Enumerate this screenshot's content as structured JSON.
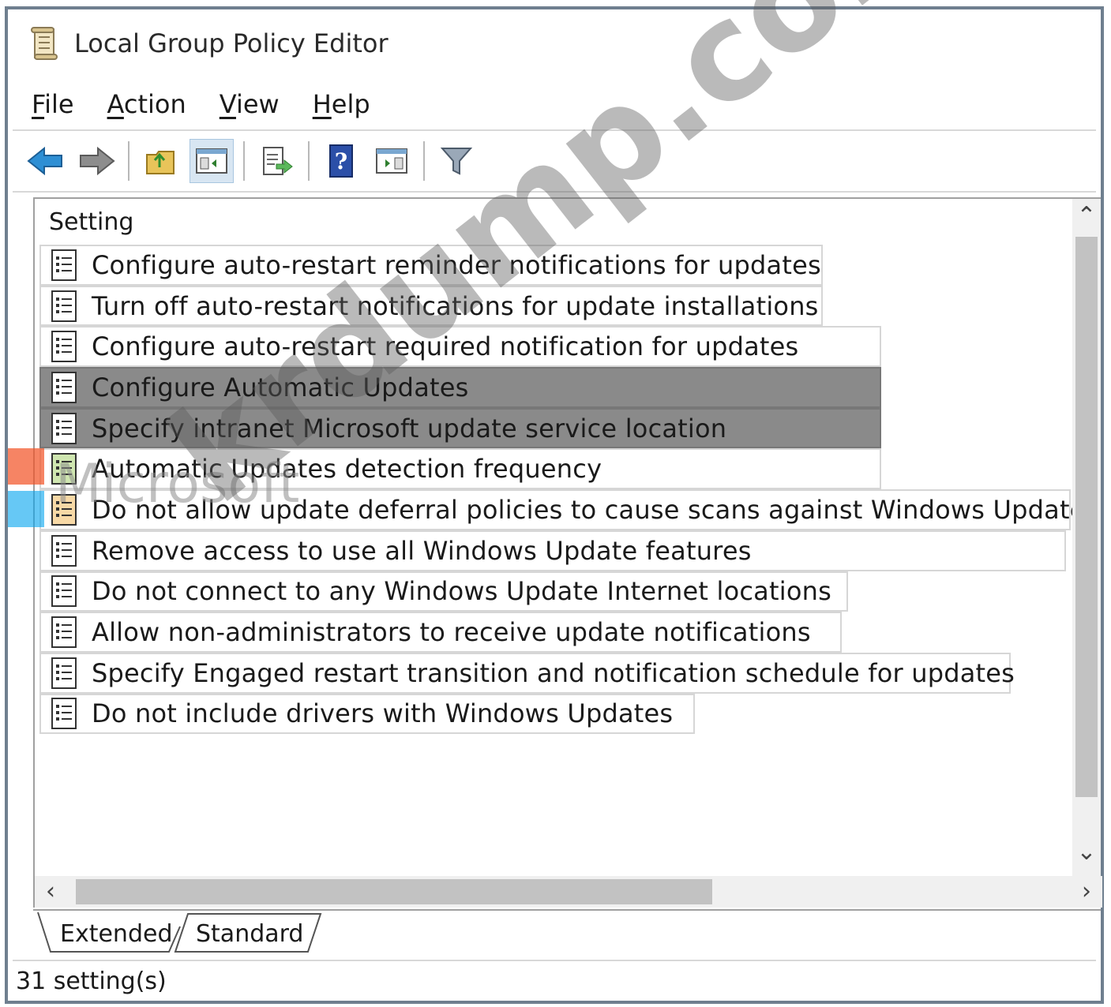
{
  "window": {
    "title": "Local Group Policy Editor"
  },
  "menu": [
    {
      "label": "File",
      "accel": "F",
      "rest": "ile"
    },
    {
      "label": "Action",
      "accel": "A",
      "rest": "ction"
    },
    {
      "label": "View",
      "accel": "V",
      "rest": "iew"
    },
    {
      "label": "Help",
      "accel": "H",
      "rest": "elp"
    }
  ],
  "toolbar": {
    "buttons": [
      "back-icon",
      "forward-icon",
      "up-folder-icon",
      "show-hide-tree-icon",
      "export-list-icon",
      "help-icon",
      "show-hide-action-pane-icon",
      "filter-icon"
    ]
  },
  "list": {
    "column_header": "Setting",
    "rows": [
      {
        "label": "Configure auto-restart reminder notifications for updates",
        "selected": false
      },
      {
        "label": "Turn off auto-restart notifications for update installations",
        "selected": false
      },
      {
        "label": "Configure auto-restart required notification for updates",
        "selected": false
      },
      {
        "label": "Configure Automatic Updates",
        "selected": true
      },
      {
        "label": "Specify intranet Microsoft update service location",
        "selected": true
      },
      {
        "label": "Automatic Updates detection frequency",
        "selected": false
      },
      {
        "label": "Do not allow update deferral policies to cause scans against Windows Update",
        "selected": false
      },
      {
        "label": "Remove access to use all Windows Update features",
        "selected": false
      },
      {
        "label": "Do not connect to any Windows Update Internet locations",
        "selected": false
      },
      {
        "label": "Allow non-administrators to receive update notifications",
        "selected": false
      },
      {
        "label": "Specify Engaged restart transition and notification schedule for updates",
        "selected": false
      },
      {
        "label": "Do not include drivers with Windows Updates",
        "selected": false
      }
    ]
  },
  "tabs": {
    "extended": "Extended",
    "standard": "Standard"
  },
  "status": {
    "text": "31 setting(s)"
  },
  "overlay": {
    "watermark": "krdump.com",
    "logo_text": "Microsoft"
  },
  "colors": {
    "selection": "#8a8a8a",
    "window_border": "#6f7f8f",
    "ms_red": "#f25022",
    "ms_green": "#7fba00",
    "ms_blue": "#00a4ef",
    "ms_yellow": "#ffb900"
  }
}
